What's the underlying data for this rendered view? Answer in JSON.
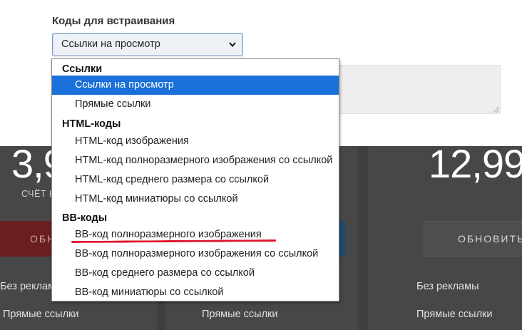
{
  "embed": {
    "label": "Коды для встраивания",
    "select_value": "Ссылки на просмотр",
    "chevron_icon": "chevron-down-icon"
  },
  "dropdown": {
    "groups": [
      {
        "label": "Ссылки",
        "options": [
          "Ссылки на просмотр",
          "Прямые ссылки"
        ]
      },
      {
        "label": "HTML-коды",
        "options": [
          "HTML-код изображения",
          "HTML-код полноразмерного изображения со ссылкой",
          "HTML-код среднего размера со ссылкой",
          "HTML-код миниатюры со ссылкой"
        ]
      },
      {
        "label": "BB-коды",
        "options": [
          "BB-код полноразмерного изображения",
          "BB-код полноразмерного изображения со ссылкой",
          "BB-код среднего размера со ссылкой",
          "BB-код миниатюры со ссылкой"
        ]
      }
    ],
    "selected": "Ссылки на просмотр",
    "highlight_color": "#1a6fd8",
    "annotation_color": "#e0142b"
  },
  "pricing": {
    "left": {
      "price": "3,9",
      "period": "СЧЁТ Н",
      "button": "ОБН",
      "features": [
        "Без рекламы",
        "Прямые ссылки"
      ]
    },
    "middle": {
      "features": [
        "Прямые ссылки"
      ]
    },
    "right": {
      "price": "12,99",
      "button": "ОБНОВИТЬ",
      "features": [
        "Без рекламы",
        "Прямые ссылки"
      ]
    }
  }
}
